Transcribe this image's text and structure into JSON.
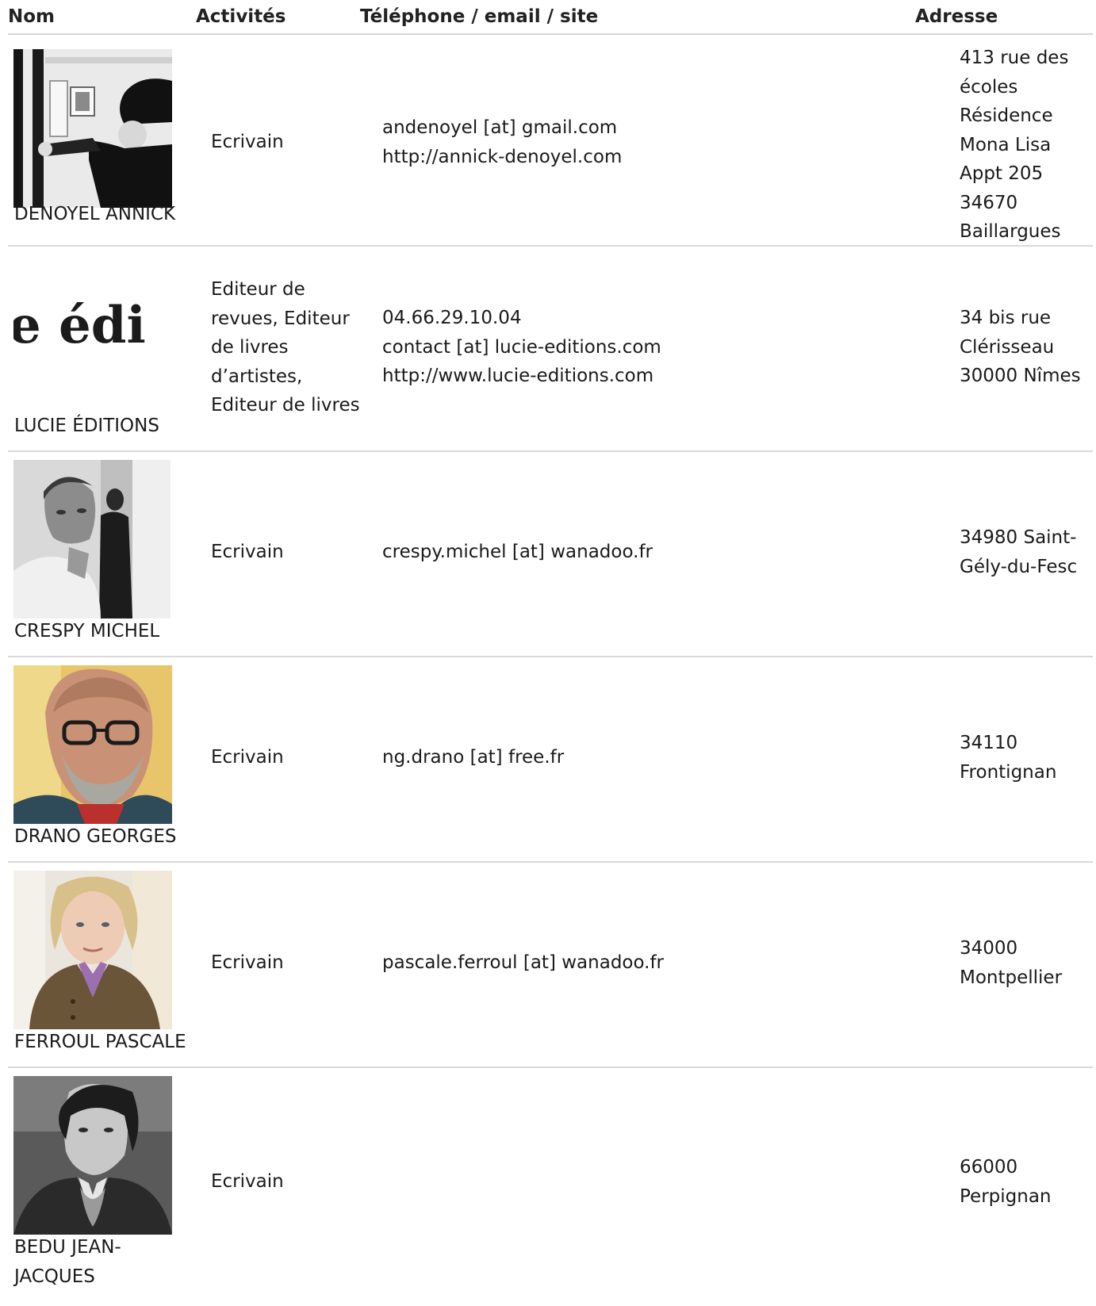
{
  "headers": {
    "nom": "Nom",
    "activites": "Activités",
    "contact": "Téléphone / email / site",
    "adresse": "Adresse"
  },
  "rows": [
    {
      "name": "DENOYEL ANNICK",
      "activity": "Ecrivain",
      "contact": [
        "andenoyel [at] gmail.com",
        "http://annick-denoyel.com"
      ],
      "address": [
        "413 rue des",
        "écoles",
        "Résidence",
        "Mona Lisa",
        "Appt 205",
        "34670",
        "Baillargues"
      ]
    },
    {
      "name": "LUCIE ÉDITIONS",
      "logo_text": "e édi",
      "activity_lines": [
        "Editeur de",
        "revues, Editeur",
        "de livres",
        "d’artistes,",
        "Editeur de livres"
      ],
      "contact": [
        "04.66.29.10.04",
        "contact [at] lucie-editions.com",
        "http://www.lucie-editions.com"
      ],
      "address": [
        "34 bis rue",
        "Clérisseau",
        "30000 Nîmes"
      ]
    },
    {
      "name": "CRESPY MICHEL",
      "activity": "Ecrivain",
      "contact": [
        "crespy.michel [at] wanadoo.fr"
      ],
      "address": [
        "34980 Saint-",
        "Gély-du-Fesc"
      ]
    },
    {
      "name": "DRANO GEORGES",
      "activity": "Ecrivain",
      "contact": [
        "ng.drano [at] free.fr"
      ],
      "address": [
        "34110",
        "Frontignan"
      ]
    },
    {
      "name": "FERROUL PASCALE",
      "activity": "Ecrivain",
      "contact": [
        "pascale.ferroul [at] wanadoo.fr"
      ],
      "address": [
        "34000",
        "Montpellier"
      ]
    },
    {
      "name_lines": [
        "BEDU JEAN-",
        "JACQUES"
      ],
      "activity": "Ecrivain",
      "contact": [],
      "address": [
        "66000",
        "Perpignan"
      ]
    }
  ]
}
